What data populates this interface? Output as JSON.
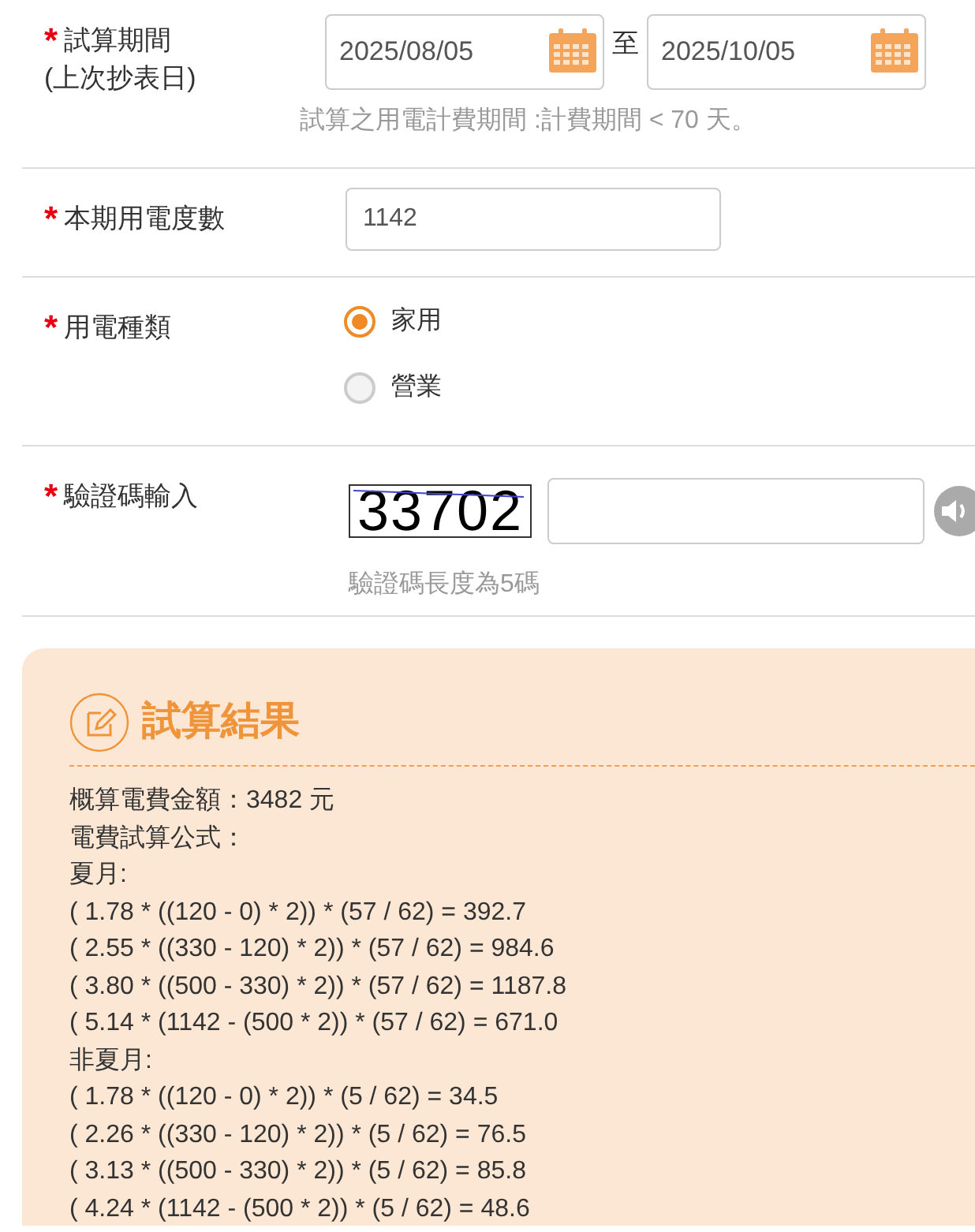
{
  "period": {
    "required": "*",
    "label": "試算期間",
    "sublabel": "(上次抄表日)",
    "start": "2025/08/05",
    "separator": "至",
    "end": "2025/10/05",
    "hint": "試算之用電計費期間 :計費期間 < 70 天。"
  },
  "usage": {
    "required": "*",
    "label": "本期用電度數",
    "value": "1142"
  },
  "type": {
    "required": "*",
    "label": "用電種類",
    "options": [
      {
        "label": "家用",
        "selected": true
      },
      {
        "label": "營業",
        "selected": false
      }
    ]
  },
  "captcha": {
    "required": "*",
    "label": "驗證碼輸入",
    "code": "33702",
    "hint": "驗證碼長度為5碼"
  },
  "result": {
    "title": "試算結果",
    "lines": [
      "概算電費金額：3482 元",
      "電費試算公式：",
      "夏月:",
      "( 1.78 * ((120 - 0) * 2)) * (57 / 62) = 392.7",
      "( 2.55 * ((330 - 120) * 2)) * (57 / 62) = 984.6",
      "( 3.80 * ((500 - 330) * 2)) * (57 / 62) = 1187.8",
      "( 5.14 * (1142 - (500 * 2)) * (57 / 62) = 671.0",
      "非夏月:",
      "( 1.78 * ((120 - 0) * 2)) * (5 / 62) = 34.5",
      "( 2.26 * ((330 - 120) * 2)) * (5 / 62) = 76.5",
      "( 3.13 * ((500 - 330) * 2)) * (5 / 62) = 85.8",
      "( 4.24 * (1142 - (500 * 2)) * (5 / 62) = 48.6"
    ]
  }
}
